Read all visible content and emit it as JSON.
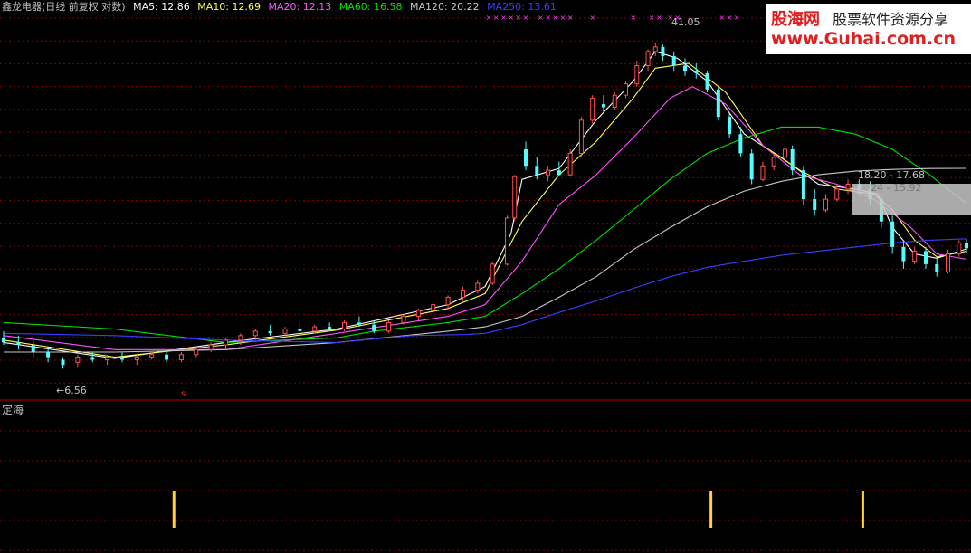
{
  "header": {
    "stock": "鑫龙电器(日线 前复权 对数)",
    "ma5": "MA5: 12.86",
    "ma10": "MA10: 12.69",
    "ma20": "MA20: 12.13",
    "ma60": "MA60: 16.58",
    "ma120": "MA120: 20.22",
    "ma250": "MA250: 13.61"
  },
  "logo": {
    "brand": "股海网",
    "slogan": "股票软件资源分享",
    "url": "www.Guhai.com.cn"
  },
  "annotations": {
    "high": "41.05",
    "low": "6.56",
    "range_top": "18.20 - 17.68",
    "range_bottom": "24 - 15.92",
    "signal": "s"
  },
  "subchart": {
    "title": "定海"
  },
  "colors": {
    "bg": "#000000",
    "up": "#ff5050",
    "down": "#54fcfc",
    "ma5": "#ffffff",
    "ma10": "#ffff54",
    "ma20": "#ff54ff",
    "ma60": "#00e000",
    "ma120": "#c8c8c8",
    "ma250": "#3c3cff",
    "grid": "#8b0000",
    "signal": "#ffd040",
    "marker": "#ff40ff"
  },
  "chart_data": {
    "type": "candlestick",
    "scale": "log",
    "ylim": [
      5.5,
      48
    ],
    "x_count": 260,
    "candles": [
      {
        "i": 0,
        "o": 7.8,
        "h": 8.1,
        "l": 7.5,
        "c": 7.6
      },
      {
        "i": 4,
        "o": 7.6,
        "h": 7.9,
        "l": 7.3,
        "c": 7.5
      },
      {
        "i": 8,
        "o": 7.5,
        "h": 7.7,
        "l": 7.0,
        "c": 7.2
      },
      {
        "i": 12,
        "o": 7.2,
        "h": 7.4,
        "l": 6.8,
        "c": 7.0
      },
      {
        "i": 16,
        "o": 6.9,
        "h": 7.0,
        "l": 6.56,
        "c": 6.7
      },
      {
        "i": 20,
        "o": 6.8,
        "h": 7.1,
        "l": 6.6,
        "c": 7.0
      },
      {
        "i": 24,
        "o": 7.0,
        "h": 7.2,
        "l": 6.8,
        "c": 6.9
      },
      {
        "i": 28,
        "o": 6.9,
        "h": 7.1,
        "l": 6.7,
        "c": 7.0
      },
      {
        "i": 32,
        "o": 7.0,
        "h": 7.2,
        "l": 6.8,
        "c": 6.9
      },
      {
        "i": 36,
        "o": 6.9,
        "h": 7.1,
        "l": 6.7,
        "c": 7.0
      },
      {
        "i": 40,
        "o": 7.0,
        "h": 7.2,
        "l": 6.9,
        "c": 7.1
      },
      {
        "i": 44,
        "o": 7.1,
        "h": 7.2,
        "l": 6.8,
        "c": 6.9
      },
      {
        "i": 48,
        "o": 6.9,
        "h": 7.2,
        "l": 6.8,
        "c": 7.1
      },
      {
        "i": 52,
        "o": 7.1,
        "h": 7.4,
        "l": 7.0,
        "c": 7.3
      },
      {
        "i": 56,
        "o": 7.3,
        "h": 7.6,
        "l": 7.2,
        "c": 7.5
      },
      {
        "i": 60,
        "o": 7.5,
        "h": 7.8,
        "l": 7.3,
        "c": 7.7
      },
      {
        "i": 64,
        "o": 7.7,
        "h": 8.0,
        "l": 7.5,
        "c": 7.9
      },
      {
        "i": 68,
        "o": 7.9,
        "h": 8.2,
        "l": 7.7,
        "c": 8.1
      },
      {
        "i": 72,
        "o": 8.1,
        "h": 8.4,
        "l": 7.9,
        "c": 8.0
      },
      {
        "i": 76,
        "o": 8.0,
        "h": 8.3,
        "l": 7.9,
        "c": 8.2
      },
      {
        "i": 80,
        "o": 8.2,
        "h": 8.5,
        "l": 8.0,
        "c": 8.1
      },
      {
        "i": 84,
        "o": 8.1,
        "h": 8.4,
        "l": 8.0,
        "c": 8.3
      },
      {
        "i": 88,
        "o": 8.3,
        "h": 8.5,
        "l": 8.1,
        "c": 8.2
      },
      {
        "i": 92,
        "o": 8.2,
        "h": 8.6,
        "l": 8.1,
        "c": 8.5
      },
      {
        "i": 96,
        "o": 8.5,
        "h": 8.8,
        "l": 8.3,
        "c": 8.4
      },
      {
        "i": 100,
        "o": 8.4,
        "h": 8.6,
        "l": 8.0,
        "c": 8.1
      },
      {
        "i": 104,
        "o": 8.1,
        "h": 8.6,
        "l": 8.0,
        "c": 8.5
      },
      {
        "i": 108,
        "o": 8.5,
        "h": 8.9,
        "l": 8.4,
        "c": 8.8
      },
      {
        "i": 112,
        "o": 8.8,
        "h": 9.2,
        "l": 8.6,
        "c": 9.1
      },
      {
        "i": 116,
        "o": 9.1,
        "h": 9.5,
        "l": 8.9,
        "c": 9.4
      },
      {
        "i": 120,
        "o": 9.4,
        "h": 9.9,
        "l": 9.2,
        "c": 9.8
      },
      {
        "i": 124,
        "o": 9.8,
        "h": 10.4,
        "l": 9.6,
        "c": 10.2
      },
      {
        "i": 128,
        "o": 10.2,
        "h": 10.8,
        "l": 10.0,
        "c": 10.6
      },
      {
        "i": 132,
        "o": 10.6,
        "h": 12.0,
        "l": 10.5,
        "c": 11.8
      },
      {
        "i": 136,
        "o": 11.8,
        "h": 15.5,
        "l": 11.7,
        "c": 15.3
      },
      {
        "i": 138,
        "o": 15.3,
        "h": 19.5,
        "l": 15.0,
        "c": 19.3
      },
      {
        "i": 141,
        "o": 22.5,
        "h": 23.5,
        "l": 20.0,
        "c": 20.5
      },
      {
        "i": 144,
        "o": 20.5,
        "h": 21.5,
        "l": 19.0,
        "c": 19.5
      },
      {
        "i": 147,
        "o": 19.5,
        "h": 20.5,
        "l": 18.8,
        "c": 20.0
      },
      {
        "i": 150,
        "o": 20.0,
        "h": 21.0,
        "l": 19.3,
        "c": 19.5
      },
      {
        "i": 153,
        "o": 19.5,
        "h": 22.5,
        "l": 19.4,
        "c": 22.0
      },
      {
        "i": 156,
        "o": 22.0,
        "h": 27.0,
        "l": 21.5,
        "c": 26.5
      },
      {
        "i": 159,
        "o": 26.5,
        "h": 30.5,
        "l": 26.0,
        "c": 30.0
      },
      {
        "i": 162,
        "o": 29.0,
        "h": 30.5,
        "l": 27.5,
        "c": 28.5
      },
      {
        "i": 165,
        "o": 28.5,
        "h": 31.0,
        "l": 28.0,
        "c": 30.5
      },
      {
        "i": 168,
        "o": 30.5,
        "h": 33.0,
        "l": 30.0,
        "c": 32.5
      },
      {
        "i": 171,
        "o": 32.5,
        "h": 37.0,
        "l": 32.0,
        "c": 36.0
      },
      {
        "i": 174,
        "o": 36.0,
        "h": 39.5,
        "l": 35.0,
        "c": 39.0
      },
      {
        "i": 176,
        "o": 39.0,
        "h": 41.05,
        "l": 38.0,
        "c": 40.0
      },
      {
        "i": 178,
        "o": 40.0,
        "h": 40.5,
        "l": 37.0,
        "c": 38.0
      },
      {
        "i": 181,
        "o": 38.0,
        "h": 39.0,
        "l": 35.0,
        "c": 36.0
      },
      {
        "i": 184,
        "o": 36.0,
        "h": 37.5,
        "l": 34.0,
        "c": 35.0
      },
      {
        "i": 187,
        "o": 35.0,
        "h": 36.5,
        "l": 33.5,
        "c": 34.5
      },
      {
        "i": 190,
        "o": 34.5,
        "h": 35.0,
        "l": 31.0,
        "c": 31.5
      },
      {
        "i": 193,
        "o": 31.5,
        "h": 32.0,
        "l": 26.5,
        "c": 27.0
      },
      {
        "i": 196,
        "o": 27.0,
        "h": 27.5,
        "l": 24.0,
        "c": 24.5
      },
      {
        "i": 199,
        "o": 24.5,
        "h": 25.5,
        "l": 21.5,
        "c": 22.0
      },
      {
        "i": 202,
        "o": 22.0,
        "h": 22.5,
        "l": 18.5,
        "c": 19.0
      },
      {
        "i": 205,
        "o": 19.0,
        "h": 21.0,
        "l": 18.8,
        "c": 20.5
      },
      {
        "i": 208,
        "o": 20.5,
        "h": 22.0,
        "l": 20.0,
        "c": 21.5
      },
      {
        "i": 211,
        "o": 21.5,
        "h": 23.0,
        "l": 21.0,
        "c": 22.5
      },
      {
        "i": 213,
        "o": 22.5,
        "h": 23.0,
        "l": 19.5,
        "c": 20.0
      },
      {
        "i": 216,
        "o": 20.0,
        "h": 20.5,
        "l": 16.5,
        "c": 17.0
      },
      {
        "i": 219,
        "o": 17.0,
        "h": 18.0,
        "l": 15.5,
        "c": 16.0
      },
      {
        "i": 222,
        "o": 16.0,
        "h": 17.5,
        "l": 15.8,
        "c": 17.0
      },
      {
        "i": 225,
        "o": 17.0,
        "h": 18.5,
        "l": 16.8,
        "c": 18.0
      },
      {
        "i": 228,
        "o": 18.0,
        "h": 19.0,
        "l": 17.5,
        "c": 18.5
      },
      {
        "i": 231,
        "o": 18.5,
        "h": 19.0,
        "l": 17.5,
        "c": 18.0
      },
      {
        "i": 234,
        "o": 18.0,
        "h": 18.8,
        "l": 16.5,
        "c": 17.0
      },
      {
        "i": 237,
        "o": 17.0,
        "h": 17.5,
        "l": 14.5,
        "c": 15.0
      },
      {
        "i": 240,
        "o": 15.0,
        "h": 15.5,
        "l": 12.5,
        "c": 13.0
      },
      {
        "i": 243,
        "o": 13.0,
        "h": 13.5,
        "l": 11.5,
        "c": 12.0
      },
      {
        "i": 246,
        "o": 12.0,
        "h": 13.0,
        "l": 11.8,
        "c": 12.7
      },
      {
        "i": 249,
        "o": 12.7,
        "h": 13.0,
        "l": 11.5,
        "c": 11.8
      },
      {
        "i": 252,
        "o": 11.8,
        "h": 12.3,
        "l": 11.0,
        "c": 11.3
      },
      {
        "i": 255,
        "o": 11.3,
        "h": 12.8,
        "l": 11.2,
        "c": 12.5
      },
      {
        "i": 258,
        "o": 12.5,
        "h": 13.5,
        "l": 12.3,
        "c": 13.3
      },
      {
        "i": 260,
        "o": 13.3,
        "h": 13.6,
        "l": 12.6,
        "c": 12.9
      }
    ],
    "series": [
      {
        "name": "MA5",
        "key": "ma5",
        "x": [
          0,
          30,
          60,
          90,
          120,
          130,
          137,
          140,
          150,
          160,
          170,
          176,
          182,
          190,
          200,
          210,
          220,
          230,
          236,
          240,
          246,
          252,
          260
        ],
        "y": [
          7.6,
          6.95,
          7.6,
          8.2,
          9.4,
          10.4,
          14.0,
          19.0,
          20.2,
          26.5,
          33.0,
          39.0,
          37.5,
          33.0,
          24.5,
          21.5,
          18.5,
          18.0,
          17.5,
          14.5,
          12.5,
          12.2,
          12.86
        ]
      },
      {
        "name": "MA10",
        "key": "ma10",
        "x": [
          0,
          30,
          60,
          90,
          120,
          130,
          140,
          150,
          160,
          170,
          176,
          185,
          195,
          205,
          215,
          225,
          235,
          240,
          246,
          252,
          260
        ],
        "y": [
          7.7,
          7.0,
          7.5,
          8.15,
          9.2,
          10.0,
          15.0,
          19.5,
          23.5,
          30.0,
          35.5,
          36.5,
          31.0,
          23.0,
          20.0,
          18.0,
          17.5,
          16.0,
          13.5,
          12.3,
          12.69
        ]
      },
      {
        "name": "MA20",
        "key": "ma20",
        "x": [
          0,
          30,
          60,
          90,
          120,
          130,
          140,
          150,
          160,
          170,
          180,
          186,
          195,
          205,
          215,
          225,
          235,
          245,
          252,
          260
        ],
        "y": [
          7.9,
          7.3,
          7.3,
          8.0,
          8.8,
          9.4,
          12.0,
          16.5,
          19.5,
          24.0,
          30.0,
          32.0,
          29.0,
          23.0,
          19.5,
          18.5,
          17.0,
          14.5,
          12.5,
          12.13
        ]
      },
      {
        "name": "MA60",
        "key": "ma60",
        "x": [
          0,
          30,
          60,
          90,
          100,
          120,
          130,
          140,
          150,
          160,
          170,
          180,
          190,
          200,
          210,
          220,
          230,
          240,
          250,
          260
        ],
        "y": [
          8.5,
          8.2,
          7.6,
          7.8,
          8.1,
          8.5,
          8.8,
          10.0,
          11.5,
          13.5,
          16.0,
          19.0,
          22.0,
          24.0,
          25.5,
          25.5,
          24.5,
          22.5,
          19.5,
          16.58
        ]
      },
      {
        "name": "MA120",
        "key": "ma120",
        "x": [
          0,
          30,
          60,
          90,
          120,
          130,
          140,
          150,
          160,
          170,
          180,
          190,
          200,
          210,
          220,
          230,
          240,
          250,
          260
        ],
        "y": [
          7.2,
          7.2,
          7.3,
          7.6,
          8.1,
          8.3,
          8.8,
          9.8,
          11.0,
          12.8,
          14.5,
          16.3,
          17.8,
          18.8,
          19.5,
          19.9,
          20.1,
          20.2,
          20.22
        ]
      },
      {
        "name": "MA250",
        "key": "ma250",
        "x": [
          0,
          30,
          60,
          90,
          110,
          125,
          130,
          140,
          150,
          160,
          170,
          180,
          190,
          200,
          210,
          220,
          230,
          240,
          250,
          260
        ],
        "y": [
          8.0,
          7.9,
          7.7,
          7.6,
          7.9,
          7.95,
          8.0,
          8.4,
          9.0,
          9.6,
          10.3,
          11.0,
          11.6,
          12.0,
          12.4,
          12.7,
          13.0,
          13.3,
          13.5,
          13.61
        ]
      }
    ],
    "markers_top": [
      131,
      133,
      135,
      137,
      139,
      141,
      145,
      147,
      149,
      151,
      153,
      159,
      170,
      175,
      177,
      180,
      182,
      194,
      196,
      198
    ],
    "signals_sub": [
      46,
      191,
      232
    ]
  }
}
